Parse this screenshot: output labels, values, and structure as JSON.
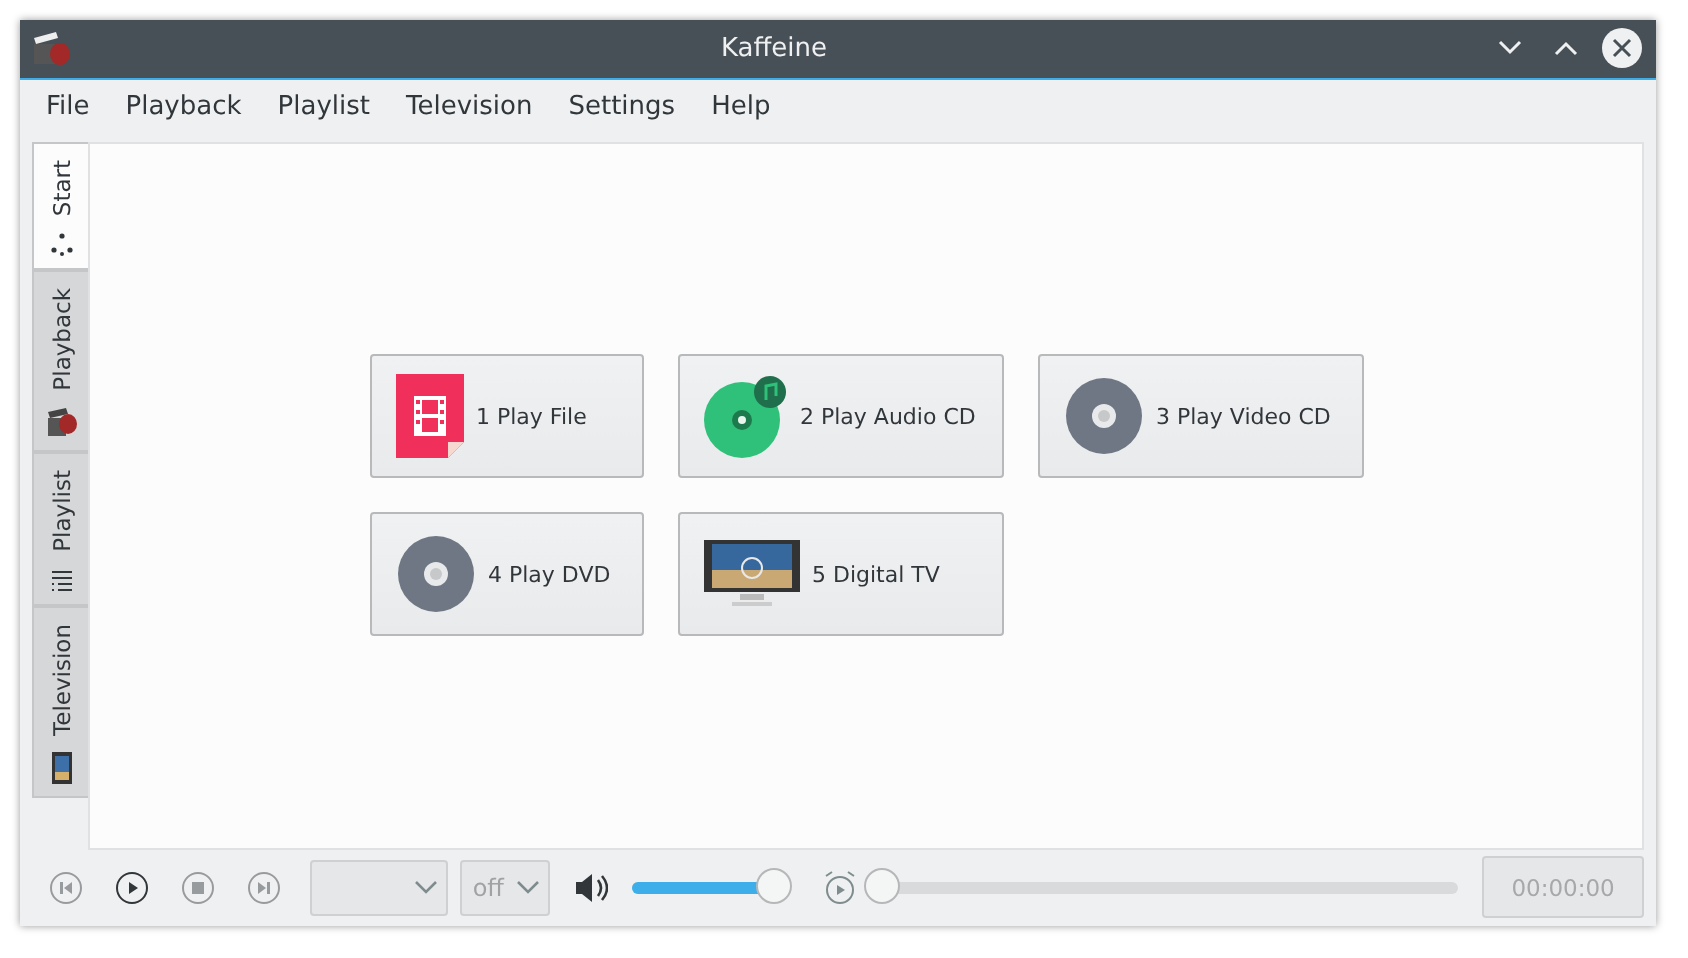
{
  "window": {
    "title": "Kaffeine"
  },
  "menu": [
    "File",
    "Playback",
    "Playlist",
    "Television",
    "Settings",
    "Help"
  ],
  "side_tabs": [
    {
      "label": "Start",
      "kind": "start",
      "selected": true
    },
    {
      "label": "Playback",
      "kind": "playback",
      "selected": false
    },
    {
      "label": "Playlist",
      "kind": "playlist",
      "selected": false
    },
    {
      "label": "Television",
      "kind": "tv",
      "selected": false
    }
  ],
  "start_buttons": [
    {
      "label": "1 Play File",
      "kind": "file"
    },
    {
      "label": "2 Play Audio CD",
      "kind": "audio"
    },
    {
      "label": "3 Play Video CD",
      "kind": "disc"
    },
    {
      "label": "4 Play DVD",
      "kind": "disc"
    },
    {
      "label": "5 Digital TV",
      "kind": "tv"
    }
  ],
  "controls": {
    "transport": [
      {
        "kind": "previous",
        "disabled": true
      },
      {
        "kind": "play",
        "disabled": false
      },
      {
        "kind": "stop",
        "disabled": true
      },
      {
        "kind": "next",
        "disabled": true
      }
    ],
    "combo_1": {
      "disabled": true
    },
    "combo_2": {
      "value": "off",
      "disabled": true
    },
    "volume": {
      "level": 0.9
    },
    "seek": {
      "level": 0
    },
    "time": "00:00:00"
  }
}
